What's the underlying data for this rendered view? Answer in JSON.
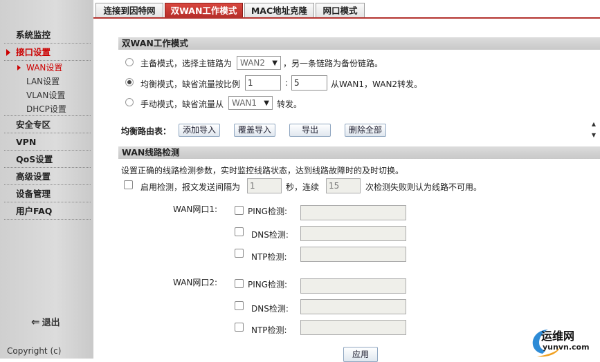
{
  "tabs": [
    "连接到因特网",
    "双WAN工作模式",
    "MAC地址克隆",
    "网口模式"
  ],
  "sidebar": {
    "items": [
      {
        "label": "系统监控"
      },
      {
        "label": "接口设置"
      },
      {
        "label": "安全专区"
      },
      {
        "label": "VPN"
      },
      {
        "label": "QoS设置"
      },
      {
        "label": "高级设置"
      },
      {
        "label": "设备管理"
      },
      {
        "label": "用户FAQ"
      }
    ],
    "sub_items": [
      {
        "label": "WAN设置"
      },
      {
        "label": "LAN设置"
      },
      {
        "label": "VLAN设置"
      },
      {
        "label": "DHCP设置"
      }
    ],
    "logout": "退出",
    "copyright": "Copyright (c)"
  },
  "dual_wan": {
    "title": "双WAN工作模式",
    "primary_mode": {
      "prefix": "主备模式，选择主链路为",
      "select_value": "WAN2",
      "suffix": "，另一条链路为备份链路。"
    },
    "balance_mode": {
      "prefix": "均衡模式，缺省流量按比例",
      "ratio1": "1",
      "colon": ":",
      "ratio2": "5",
      "suffix": "从WAN1，WAN2转发。"
    },
    "manual_mode": {
      "prefix": "手动模式，缺省流量从",
      "select_value": "WAN1",
      "suffix": "转发。"
    },
    "route_table_label": "均衡路由表：",
    "buttons": {
      "add_import": "添加导入",
      "overwrite_import": "覆盖导入",
      "export": "导出",
      "delete_all": "删除全部"
    }
  },
  "detection": {
    "title": "WAN线路检测",
    "description": "设置正确的线路检测参数，实时监控线路状态，达到线路故障时的及时切换。",
    "enable": {
      "prefix": "启用检测，报文发送间隔为",
      "interval": "1",
      "unit": "秒，连续",
      "count": "15",
      "suffix": "次检测失败则认为线路不可用。"
    },
    "ports": [
      {
        "label": "WAN网口1:",
        "ping": "PING检测:",
        "dns": "DNS检测:",
        "ntp": "NTP检测:"
      },
      {
        "label": "WAN网口2:",
        "ping": "PING检测:",
        "dns": "DNS检测:",
        "ntp": "NTP检测:"
      }
    ],
    "apply": "应用"
  },
  "watermark": {
    "cn": "运维网",
    "url": "yunvn.com"
  },
  "colors": {
    "accent": "#b52d28",
    "sidebar": "#d4d4d4",
    "header": "#cfcfcf"
  }
}
